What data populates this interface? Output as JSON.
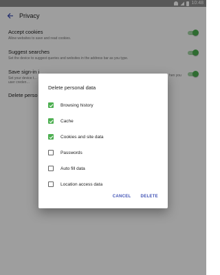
{
  "status_bar": {
    "time": "10:48"
  },
  "toolbar": {
    "title": "Privacy"
  },
  "settings": [
    {
      "title": "Accept cookies",
      "summary": "Allow websites to save and read cookies.",
      "toggle": true
    },
    {
      "title": "Suggest searches",
      "summary": "Set the device to suggest queries and websites in the address bar as you type.",
      "toggle": true
    },
    {
      "title": "Save sign-in i",
      "summary": "Set your device t… enter user creden…",
      "summary_right": "hen you",
      "toggle": true
    },
    {
      "title": "Delete perso"
    }
  ],
  "dialog": {
    "title": "Delete personal data",
    "options": [
      {
        "label": "Browsing history",
        "checked": true
      },
      {
        "label": "Cache",
        "checked": true
      },
      {
        "label": "Cookies and site data",
        "checked": true
      },
      {
        "label": "Passwords",
        "checked": false
      },
      {
        "label": "Auto fill data",
        "checked": false
      },
      {
        "label": "Location access data",
        "checked": false
      }
    ],
    "cancel_label": "CANCEL",
    "delete_label": "DELETE"
  },
  "colors": {
    "accent": "#3f51b5",
    "toggle_on": "#4caf50",
    "scrim": "rgba(0,0,0,0.38)"
  }
}
